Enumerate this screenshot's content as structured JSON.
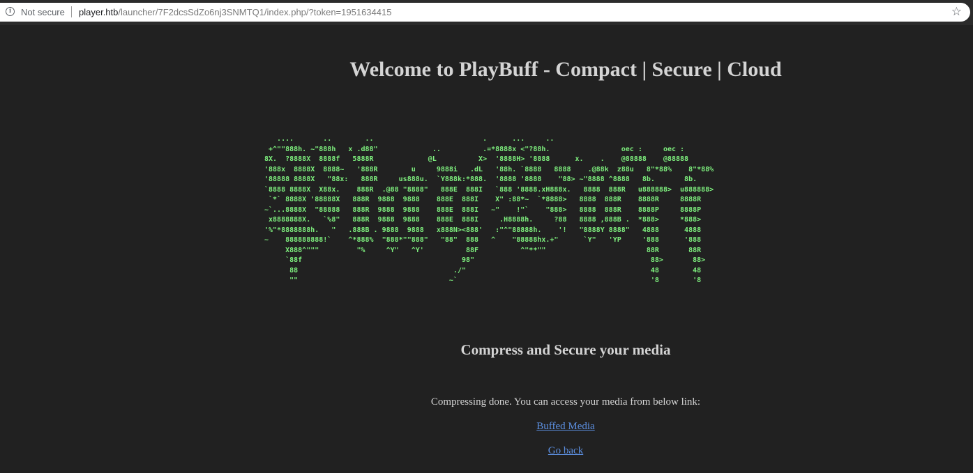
{
  "browser": {
    "security_label": "Not secure",
    "url_host": "player.htb",
    "url_path": "/launcher/7F2dcsSdZo6nj3SNMTQ1/index.php/?token=1951634415",
    "icons": [
      "info-icon",
      "bookmark-star-icon"
    ]
  },
  "page": {
    "title": "Welcome to PlayBuff - Compact | Secure | Cloud",
    "ascii_logo": "   ....       ..        ..                          .      ...     ..\n +^\"\"888h. ~\"888h   x .d88\"             ..          .=*8888x <\"?88h.                 oec :     oec :\n8X.  ?8888X  8888f   5888R             @L          X>  '8888H> '8888      x.    .    @88888    @88888\n'888x  8888X  8888~   '888R        u     9888i   .dL   '88h. `8888   8888    .@88k  z88u   8\"*88%    8\"*88%\n'88888 8888X   \"88x:   888R     us888u.  `Y888k:*888.  '8888 '8888    \"88> ~\"8888 ^8888   8b.       8b.\n`8888 8888X  X88x.    888R  .@88 \"8888\"   888E  888I   `888 '8888.xH888x.   8888  888R   u888888>  u888888>\n `*` 8888X '88888X   888R  9888  9888    888E  888I    X\" :88*~  `*8888>   8888  888R    8888R     8888R\n~`...8888X  \"88888   888R  9888  9888    888E  888I   ~\"    !\"`    \"888>   8888  888R    8888P     8888P\n x8888888X.   `%8\"   888R  9888  9888    888E  888I     .H8888h.     ?88   8888 ,888B .  *888>     *888>\n'%\"*8888888h.   \"   .888B . 9888  9888   x888N><888'   :\"^\"88888h.    '!   \"8888Y 8888\"   4888      4888\n~    888888888!`    ^*888%  \"888*\"\"888\"   \"88\"  888   ^    \"88888hx.+\"      `Y\"   'YP     '888      '888\n     X888^\"\"\"         \"%     ^Y\"   ^Y'          88F          ^\"**\"\"                        88R       88R\n     `88f                                      98\"                                          88>       88>\n      88                                     ./\"                                            48        48\n      \"\"                                    ~`                                              '8        '8",
    "subtitle": "Compress and Secure your media",
    "message": "Compressing done. You can access your media from below link:",
    "media_link": "Buffed Media",
    "back_link": "Go back"
  }
}
